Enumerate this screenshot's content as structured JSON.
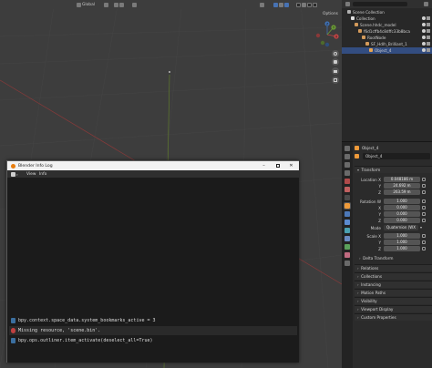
{
  "viewport": {
    "header": {
      "orientation": "Global",
      "options": "Options"
    },
    "colors": {
      "background": "#3d3d3d",
      "x_axis": "#8a3a3a",
      "y_axis": "#5f7a2d"
    },
    "gizmo": {
      "x": "X",
      "y": "Y",
      "z": "Z"
    }
  },
  "outliner": {
    "rows": [
      {
        "label": "Scene Collection"
      },
      {
        "label": "Collection"
      },
      {
        "label": "Scene.hhdc_model"
      },
      {
        "label": "f6d1cffb4c8dffc33b8bca"
      },
      {
        "label": "RootNode"
      },
      {
        "label": "SF_Hdlh_Brilliant_1"
      },
      {
        "label": "Object_4"
      }
    ]
  },
  "properties": {
    "object_name": "Object_4",
    "data_name": "Object_4",
    "transform_header": "Transform",
    "location_label": "Location X",
    "location": {
      "x": "0.048186 m",
      "y": "24.692 m",
      "z": "263.59 m"
    },
    "rotation_label": "Rotation W",
    "rotation": {
      "w": "1.000",
      "x": "0.000",
      "y": "0.000",
      "z": "0.000"
    },
    "mode_label": "Mode",
    "mode_value": "Quaternion (WX",
    "scale_label": "Scale X",
    "scale": {
      "x": "1.000",
      "y": "1.000",
      "z": "1.000"
    },
    "axis": {
      "y": "Y",
      "z": "Z",
      "x": "X"
    },
    "panels": [
      "Delta Transform",
      "Relations",
      "Collections",
      "Instancing",
      "Motion Paths",
      "Visibility",
      "Viewport Display",
      "Custom Properties"
    ]
  },
  "info_window": {
    "title": "Blender Info Log",
    "menu": {
      "view": "View",
      "info": "Info"
    },
    "log": [
      {
        "text": "bpy.context.space_data.system_bookmarks_active = 3",
        "type": "operator",
        "color": "#3b6fa0"
      },
      {
        "text": "Missing resource, 'scene.bin'.",
        "type": "error",
        "color": "#c04040"
      },
      {
        "text": "bpy.ops.outliner.item_activate(deselect_all=True)",
        "type": "operator",
        "color": "#3b6fa0"
      }
    ]
  }
}
